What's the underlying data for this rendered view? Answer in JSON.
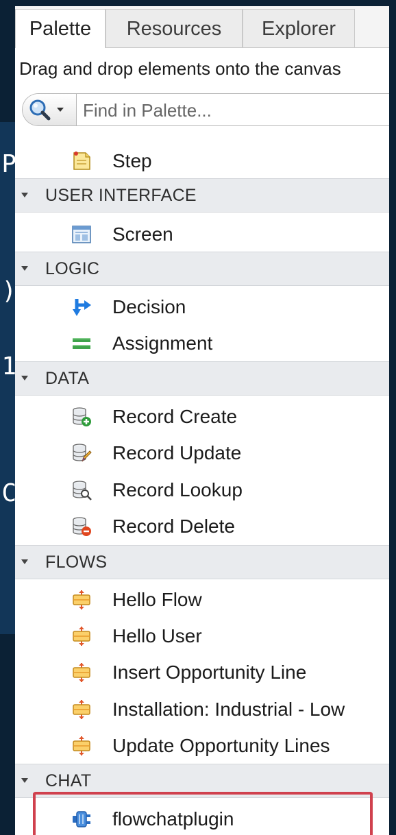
{
  "background": {
    "glyphs": [
      "P",
      ")",
      "1",
      "C"
    ],
    "corner_text": "1"
  },
  "tabs": [
    {
      "label": "Palette",
      "active": true
    },
    {
      "label": "Resources",
      "active": false
    },
    {
      "label": "Explorer",
      "active": false
    }
  ],
  "hint_text": "Drag and drop elements onto the canvas",
  "search": {
    "placeholder": "Find in Palette..."
  },
  "palette": {
    "step_label": "Step",
    "sections": {
      "user_interface": {
        "title": "USER INTERFACE",
        "items": [
          "Screen"
        ]
      },
      "logic": {
        "title": "LOGIC",
        "items": [
          "Decision",
          "Assignment"
        ]
      },
      "data": {
        "title": "DATA",
        "items": [
          "Record Create",
          "Record Update",
          "Record Lookup",
          "Record Delete"
        ]
      },
      "flows": {
        "title": "FLOWS",
        "items": [
          "Hello Flow",
          "Hello User",
          "Insert Opportunity Line",
          "Installation: Industrial - Low",
          "Update Opportunity Lines"
        ]
      },
      "chat": {
        "title": "CHAT",
        "items": [
          "flowchatplugin"
        ]
      }
    }
  },
  "colors": {
    "panel_bg": "#ffffff",
    "section_bg": "#e9ebee",
    "highlight": "#d0414e",
    "page_bg": "#0b2135"
  }
}
